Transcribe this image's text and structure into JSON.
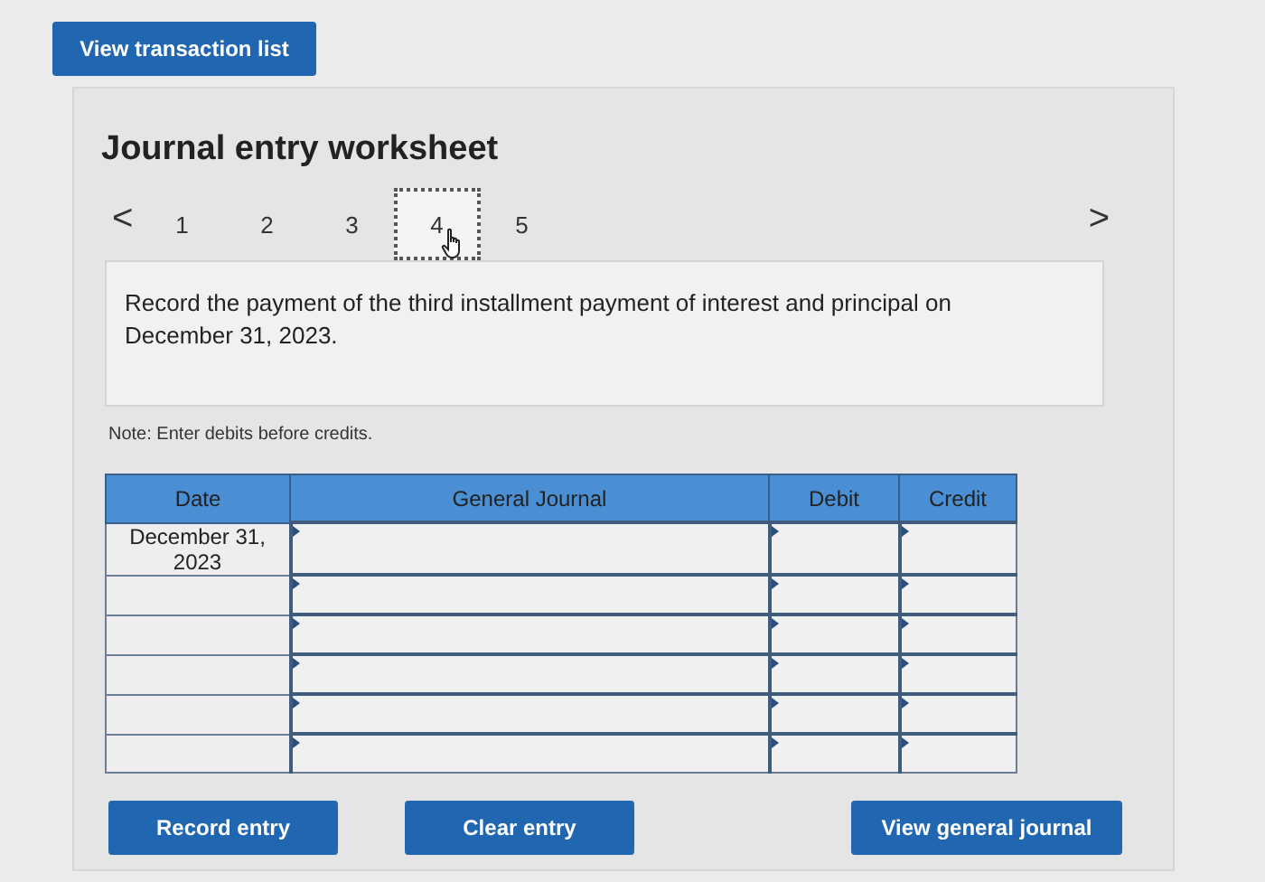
{
  "top_button": "View transaction list",
  "worksheet": {
    "title": "Journal entry worksheet",
    "prev": "<",
    "next": ">",
    "tabs": [
      {
        "label": "1",
        "selected": false,
        "hovered": false
      },
      {
        "label": "2",
        "selected": false,
        "hovered": false
      },
      {
        "label": "3",
        "selected": false,
        "hovered": false
      },
      {
        "label": "4",
        "selected": true,
        "hovered": true
      },
      {
        "label": "5",
        "selected": false,
        "hovered": false
      }
    ],
    "description": "Record the payment of the third installment payment of interest and principal on December 31, 2023.",
    "note": "Note: Enter debits before credits.",
    "table": {
      "columns": [
        "Date",
        "General Journal",
        "Debit",
        "Credit"
      ],
      "rows": [
        {
          "kind": "dated",
          "date": "December 31, 2023"
        },
        {
          "kind": "blank"
        },
        {
          "kind": "blank"
        },
        {
          "kind": "blank"
        },
        {
          "kind": "blank"
        },
        {
          "kind": "blank"
        }
      ]
    },
    "buttons": [
      "Record entry",
      "Clear entry",
      "View general journal"
    ]
  }
}
